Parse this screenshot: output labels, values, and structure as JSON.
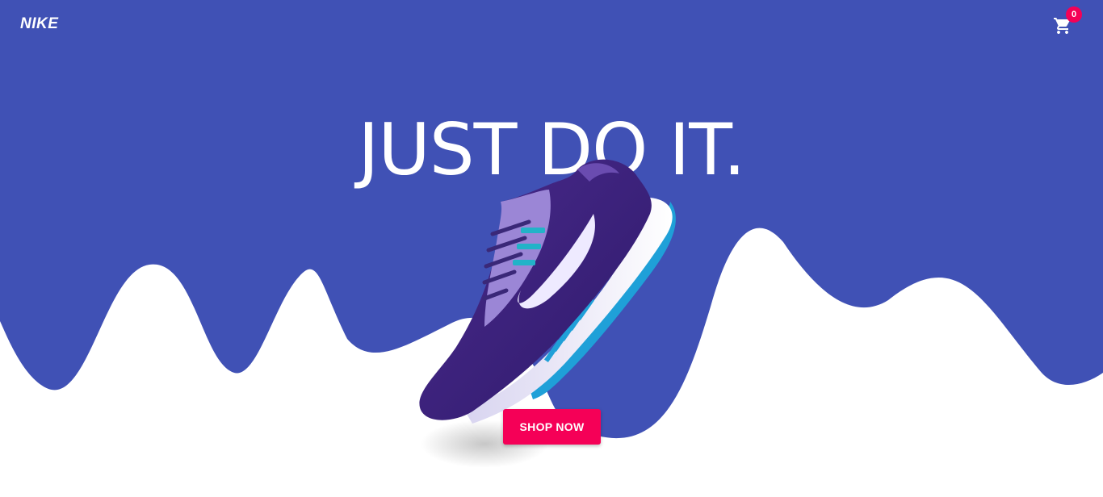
{
  "brand": {
    "logo_text": "NIKE"
  },
  "header": {
    "cart_count": "0",
    "cart_icon": "shopping-cart-icon"
  },
  "hero": {
    "headline": "JUST DO IT.",
    "cta_label": "SHOP NOW",
    "product_image": "running-shoe"
  },
  "colors": {
    "background_blue": "#4051b5",
    "accent_pink": "#f50057",
    "white": "#ffffff"
  }
}
